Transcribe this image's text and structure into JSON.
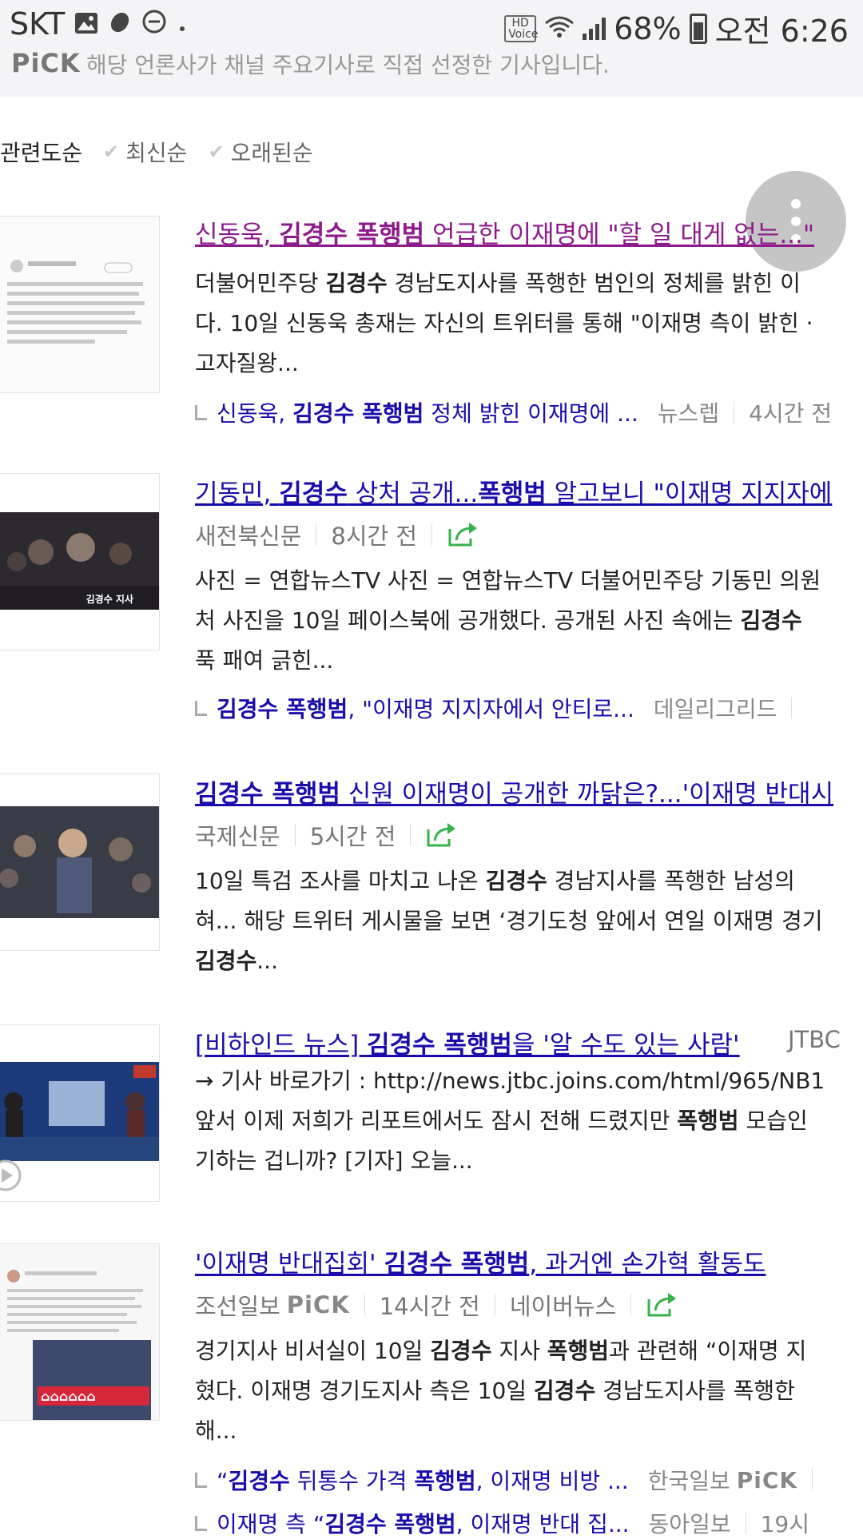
{
  "status": {
    "carrier": "SKT",
    "hd_voice": "HD Voice",
    "battery": "68%",
    "time": "오전 6:26",
    "icons": [
      "gallery-icon",
      "app-icon",
      "dnd-icon",
      "dot-icon",
      "wifi-icon",
      "signal-icon",
      "battery-icon"
    ]
  },
  "notice": {
    "pick": "PiCK",
    "text": "해당 언론사가 채널 주요기사로 직접 선정한 기사입니다."
  },
  "sort": {
    "options": [
      "관련도순",
      "최신순",
      "오래된순"
    ],
    "active": "관련도순"
  },
  "articles": [
    {
      "title_parts": [
        {
          "text": "신동욱, ",
          "bold": false
        },
        {
          "text": "김경수 폭행범",
          "bold": true
        },
        {
          "text": " 언급한 이재명에 \"할 일 대게 없는...\"",
          "bold": false
        }
      ],
      "visited": true,
      "source": "",
      "time": "",
      "body_lines": [
        [
          {
            "text": "더불어민주당 ",
            "bold": false
          },
          {
            "text": "김경수",
            "bold": true
          },
          {
            "text": " 경남도지사를 폭행한 범인의 정체를 밝힌 이",
            "bold": false
          }
        ],
        [
          {
            "text": "다. 10일 신동욱 총재는 자신의 트위터를 통해 \"이재명 측이 밝힌 ·",
            "bold": false
          }
        ],
        [
          {
            "text": "고자질왕...",
            "bold": false
          }
        ]
      ],
      "related": [
        {
          "parts": [
            {
              "text": "신동욱, ",
              "bold": false
            },
            {
              "text": "김경수 폭행범",
              "bold": true
            },
            {
              "text": " 정체 밝힌 이재명에 ...",
              "bold": false
            }
          ],
          "source": "뉴스렙",
          "time": "4시간 전"
        }
      ]
    },
    {
      "title_parts": [
        {
          "text": "기동민, ",
          "bold": false
        },
        {
          "text": "김경수",
          "bold": true
        },
        {
          "text": " 상처 공개...",
          "bold": false
        },
        {
          "text": "폭행범",
          "bold": true
        },
        {
          "text": " 알고보니 \"이재명 지지자에",
          "bold": false
        }
      ],
      "visited": false,
      "source": "새전북신문",
      "time": "8시간 전",
      "body_lines": [
        [
          {
            "text": "사진 = 연합뉴스TV 사진 = 연합뉴스TV 더불어민주당 기동민 의원",
            "bold": false
          }
        ],
        [
          {
            "text": "처 사진을 10일 페이스북에 공개했다. 공개된 사진 속에는 ",
            "bold": false
          },
          {
            "text": "김경수",
            "bold": true
          }
        ],
        [
          {
            "text": "푹 패여 긁힌...",
            "bold": false
          }
        ]
      ],
      "thumb_caption": "김경수 지사",
      "related": [
        {
          "parts": [
            {
              "text": "김경수 폭행범",
              "bold": true
            },
            {
              "text": ", \"이재명 지지자에서 안티로...",
              "bold": false
            }
          ],
          "source": "데일리그리드",
          "time": ""
        }
      ]
    },
    {
      "title_parts": [
        {
          "text": "김경수 폭행범",
          "bold": true
        },
        {
          "text": " 신원 이재명이 공개한 까닭은?...'이재명 반대시",
          "bold": false
        }
      ],
      "visited": false,
      "source": "국제신문",
      "time": "5시간 전",
      "body_lines": [
        [
          {
            "text": "10일 특검 조사를 마치고 나온 ",
            "bold": false
          },
          {
            "text": "김경수",
            "bold": true
          },
          {
            "text": " 경남지사를 폭행한 남성의",
            "bold": false
          }
        ],
        [
          {
            "text": "혀... 해당 트위터 게시물을 보면 ‘경기도청 앞에서 연일 이재명 경기",
            "bold": false
          }
        ],
        [
          {
            "text": "김경수",
            "bold": true
          },
          {
            "text": "...",
            "bold": false
          }
        ]
      ],
      "related": []
    },
    {
      "title_parts": [
        {
          "text": "[비하인드 뉴스] ",
          "bold": false
        },
        {
          "text": "김경수 폭행범",
          "bold": true
        },
        {
          "text": "을 '알 수도 있는 사람'",
          "bold": false
        }
      ],
      "visited": false,
      "title_source": "JTBC",
      "source": "",
      "time": "",
      "body_lines": [
        [
          {
            "text": "→ 기사 바로가기 : http://news.jtbc.joins.com/html/965/NB1",
            "bold": false
          }
        ],
        [
          {
            "text": "앞서 이제 저희가 리포트에서도 잠시 전해 드렸지만 ",
            "bold": false
          },
          {
            "text": "폭행범",
            "bold": true
          },
          {
            "text": " 모습인",
            "bold": false
          }
        ],
        [
          {
            "text": "기하는 겁니까? [기자] 오늘...",
            "bold": false
          }
        ]
      ],
      "related": []
    },
    {
      "title_parts": [
        {
          "text": "'이재명 반대집회' ",
          "bold": false
        },
        {
          "text": "김경수 폭행범",
          "bold": true
        },
        {
          "text": ", 과거엔 손가혁 활동도",
          "bold": false
        }
      ],
      "visited": false,
      "source": "조선일보",
      "source_pick": "PiCK",
      "time": "14시간 전",
      "portal": "네이버뉴스",
      "body_lines": [
        [
          {
            "text": "경기지사 비서실이 10일 ",
            "bold": false
          },
          {
            "text": "김경수",
            "bold": true
          },
          {
            "text": " 지사 ",
            "bold": false
          },
          {
            "text": "폭행범",
            "bold": true
          },
          {
            "text": "과 관련해 “이재명 지",
            "bold": false
          }
        ],
        [
          {
            "text": "혔다. 이재명 경기도지사 측은 10일 ",
            "bold": false
          },
          {
            "text": "김경수",
            "bold": true
          },
          {
            "text": " 경남도지사를 폭행한",
            "bold": false
          }
        ],
        [
          {
            "text": "해...",
            "bold": false
          }
        ]
      ],
      "related": [
        {
          "parts": [
            {
              "text": "“",
              "bold": false
            },
            {
              "text": "김경수",
              "bold": true
            },
            {
              "text": " 뒤통수 가격 ",
              "bold": false
            },
            {
              "text": "폭행범",
              "bold": true
            },
            {
              "text": ", 이재명 비방 ...",
              "bold": false
            }
          ],
          "source": "한국일보",
          "pick": "PiCK",
          "time": ""
        },
        {
          "parts": [
            {
              "text": "이재명 측 “",
              "bold": false
            },
            {
              "text": "김경수 폭행범",
              "bold": true
            },
            {
              "text": ", 이재명 반대 집...",
              "bold": false
            }
          ],
          "source": "동아일보",
          "time": "19시"
        }
      ]
    }
  ],
  "colors": {
    "link": "#1a0dab",
    "visited": "#8e1b8b",
    "share": "#37b24d"
  }
}
